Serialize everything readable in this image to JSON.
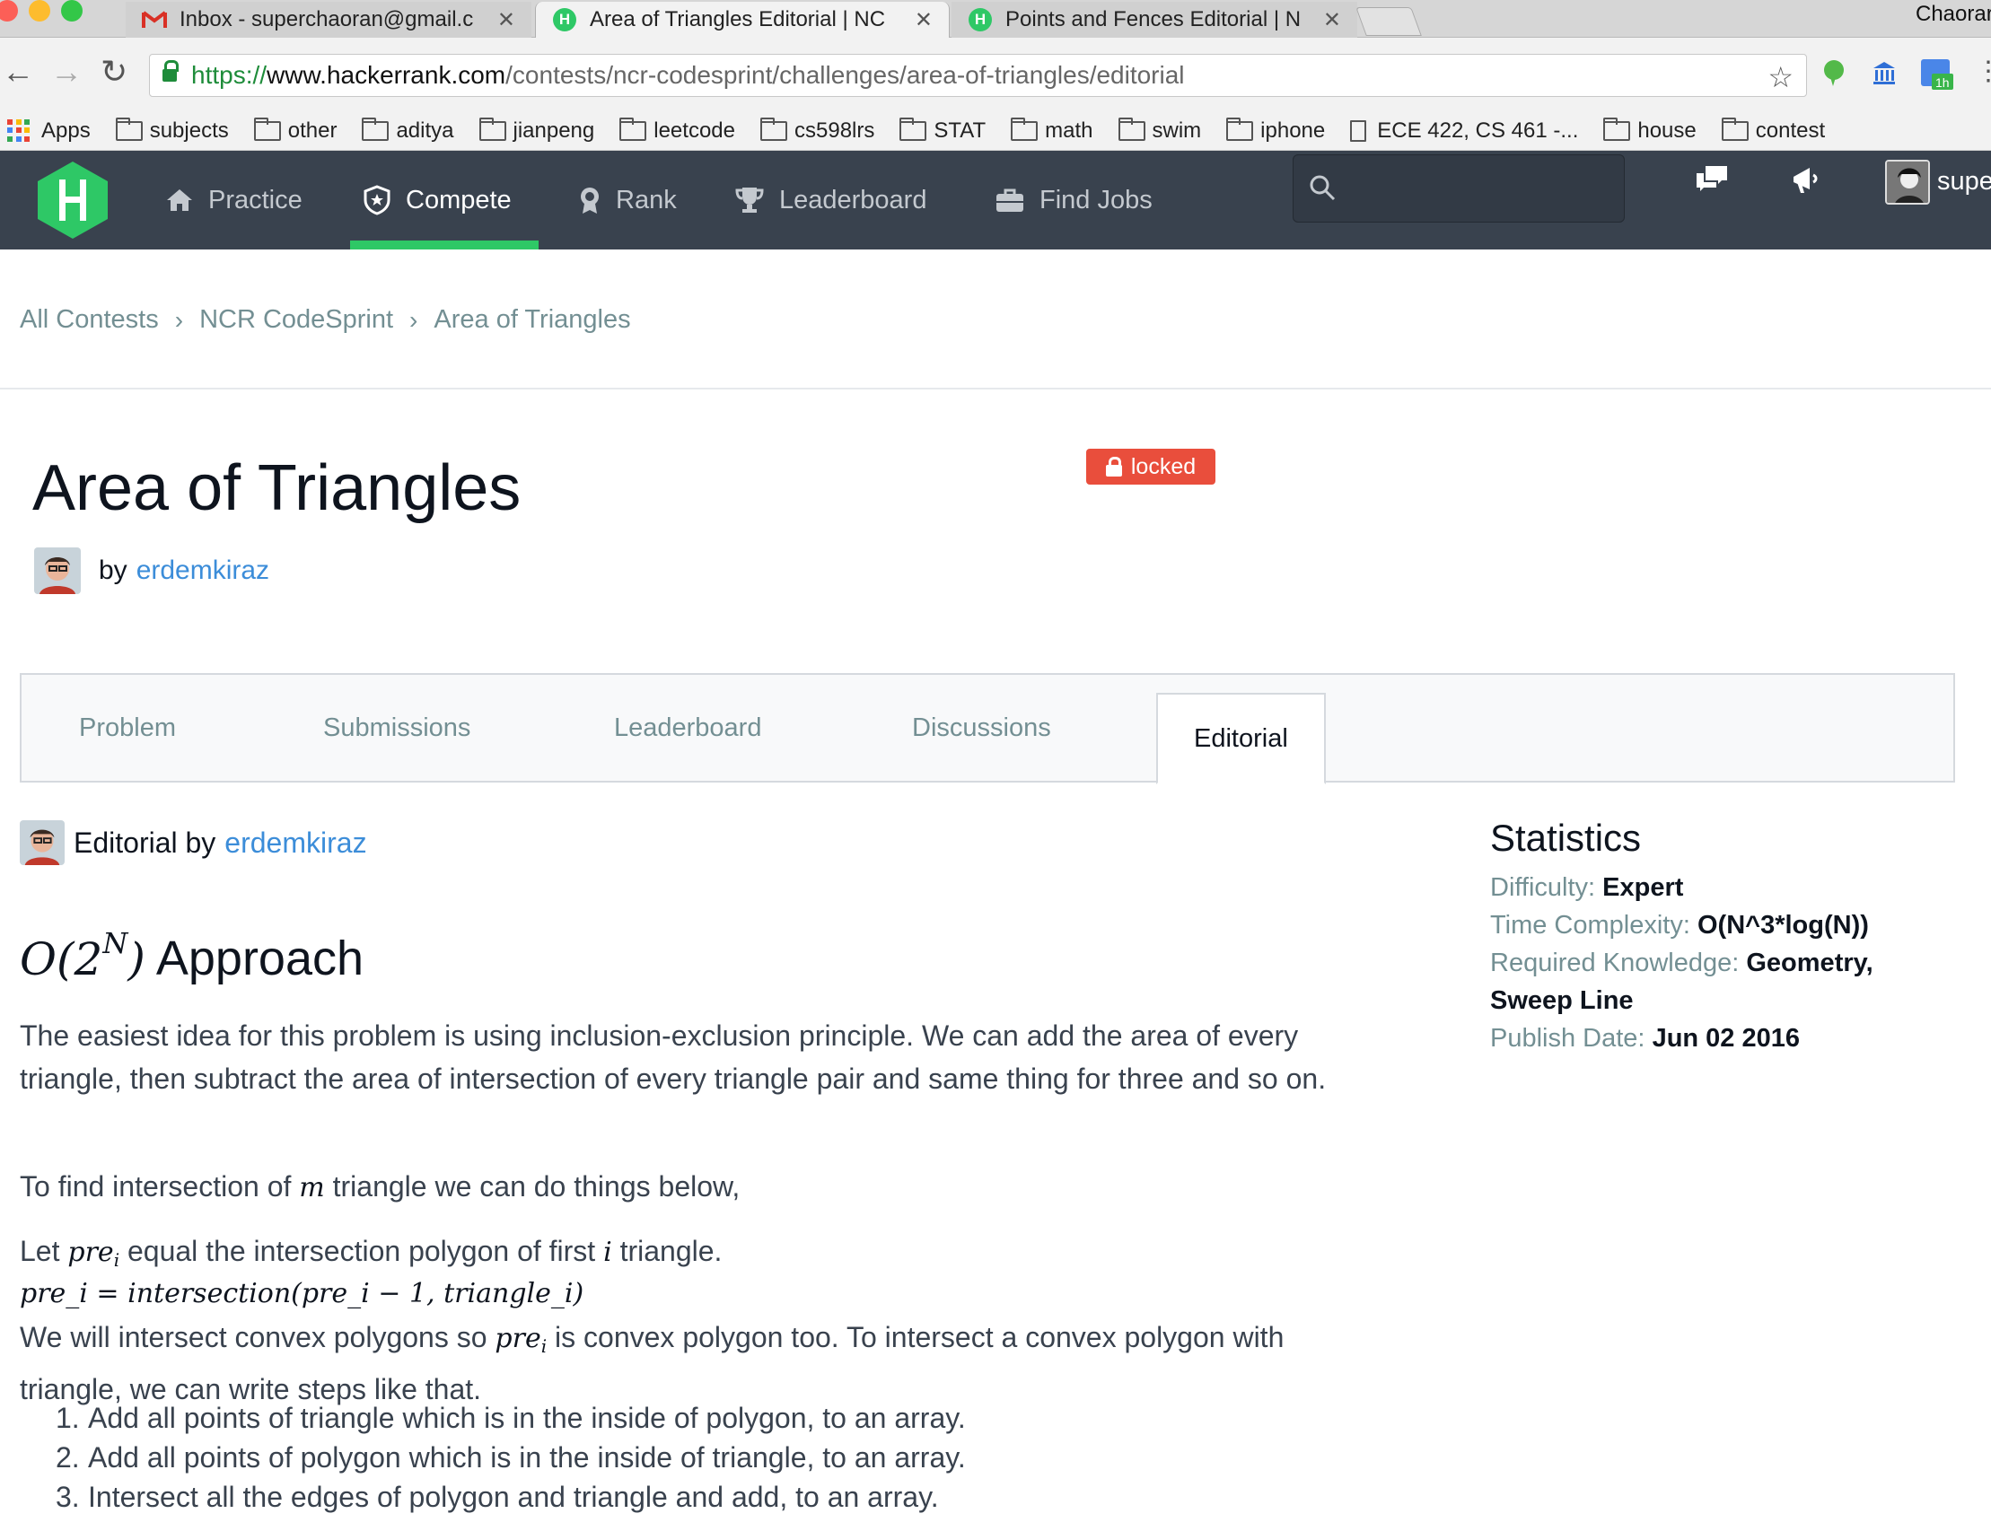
{
  "browser": {
    "tabs": [
      {
        "title": "Inbox - superchaoran@gmail.c",
        "favicon": "gmail-icon",
        "active": false
      },
      {
        "title": "Area of Triangles Editorial | NC",
        "favicon": "hackerrank-icon",
        "active": true
      },
      {
        "title": "Points and Fences Editorial | N",
        "favicon": "hackerrank-icon",
        "active": false
      }
    ],
    "profile_name": "Chaorar",
    "url": {
      "scheme": "https://",
      "host": "www.hackerrank.com",
      "path": "/contests/ncr-codesprint/challenges/area-of-triangles/editorial"
    },
    "extension_badge": "1h",
    "bookmarks": [
      {
        "label": "Apps",
        "icon": "apps-grid-icon"
      },
      {
        "label": "subjects",
        "icon": "folder-icon"
      },
      {
        "label": "other",
        "icon": "folder-icon"
      },
      {
        "label": "aditya",
        "icon": "folder-icon"
      },
      {
        "label": "jianpeng",
        "icon": "folder-icon"
      },
      {
        "label": "leetcode",
        "icon": "folder-icon"
      },
      {
        "label": "cs598lrs",
        "icon": "folder-icon"
      },
      {
        "label": "STAT",
        "icon": "folder-icon"
      },
      {
        "label": "math",
        "icon": "folder-icon"
      },
      {
        "label": "swim",
        "icon": "folder-icon"
      },
      {
        "label": "iphone",
        "icon": "folder-icon"
      },
      {
        "label": "ECE 422, CS 461 -...",
        "icon": "document-icon"
      },
      {
        "label": "house",
        "icon": "folder-icon"
      },
      {
        "label": "contest",
        "icon": "folder-icon"
      }
    ]
  },
  "nav": {
    "items": [
      {
        "label": "Practice",
        "icon": "home-icon"
      },
      {
        "label": "Compete",
        "icon": "shield-star-icon",
        "active": true
      },
      {
        "label": "Rank",
        "icon": "medal-icon"
      },
      {
        "label": "Leaderboard",
        "icon": "trophy-icon"
      },
      {
        "label": "Find Jobs",
        "icon": "briefcase-icon"
      }
    ],
    "search_placeholder": "",
    "user_label": "supe"
  },
  "breadcrumb": [
    "All Contests",
    "NCR CodeSprint",
    "Area of Triangles"
  ],
  "challenge": {
    "title": "Area of Triangles",
    "status_badge": "locked",
    "by_label": "by",
    "author": "erdemkiraz"
  },
  "content_tabs": [
    "Problem",
    "Submissions",
    "Leaderboard",
    "Discussions",
    "Editorial"
  ],
  "editorial": {
    "by_label": "Editorial by",
    "author": "erdemkiraz",
    "heading_math_base": "O(2",
    "heading_math_sup": "N",
    "heading_math_close": ")",
    "heading_text": "Approach",
    "p1": "The easiest idea for this problem is using inclusion-exclusion principle. We can add the area of every triangle, then subtract the area of intersection of every triangle pair and same thing for three and so on.",
    "p2_a": "To find intersection of",
    "p2_m": "m",
    "p2_b": "triangle we can do things below,",
    "p3_a": "Let",
    "p3_m": "pre",
    "p3_sub": "i",
    "p3_b": "equal the intersection polygon of first",
    "p3_m2": "i",
    "p3_c": "triangle.",
    "formula": "pre_i = intersection(pre_i − 1, triangle_i)",
    "p4_a": "We will intersect convex polygons so",
    "p4_b": "is convex polygon too. To intersect a convex polygon with triangle, we can write steps like that.",
    "steps": [
      "Add all points of triangle which is in the inside of polygon, to an array.",
      "Add all points of polygon which is in the inside of triangle, to an array.",
      "Intersect all the edges of polygon and triangle and add, to an array."
    ]
  },
  "statistics": {
    "title": "Statistics",
    "rows": [
      {
        "key": "Difficulty:",
        "value": "Expert"
      },
      {
        "key": "Time Complexity:",
        "value": "O(N^3*log(N))"
      },
      {
        "key": "Required Knowledge:",
        "value": "Geometry, Sweep Line"
      },
      {
        "key": "Publish Date:",
        "value": "Jun 02 2016"
      }
    ]
  },
  "colors": {
    "accent_green": "#2ec866",
    "nav_bg": "#39424e",
    "link_blue": "#3c8dd9",
    "locked_red": "#e94e3c"
  }
}
